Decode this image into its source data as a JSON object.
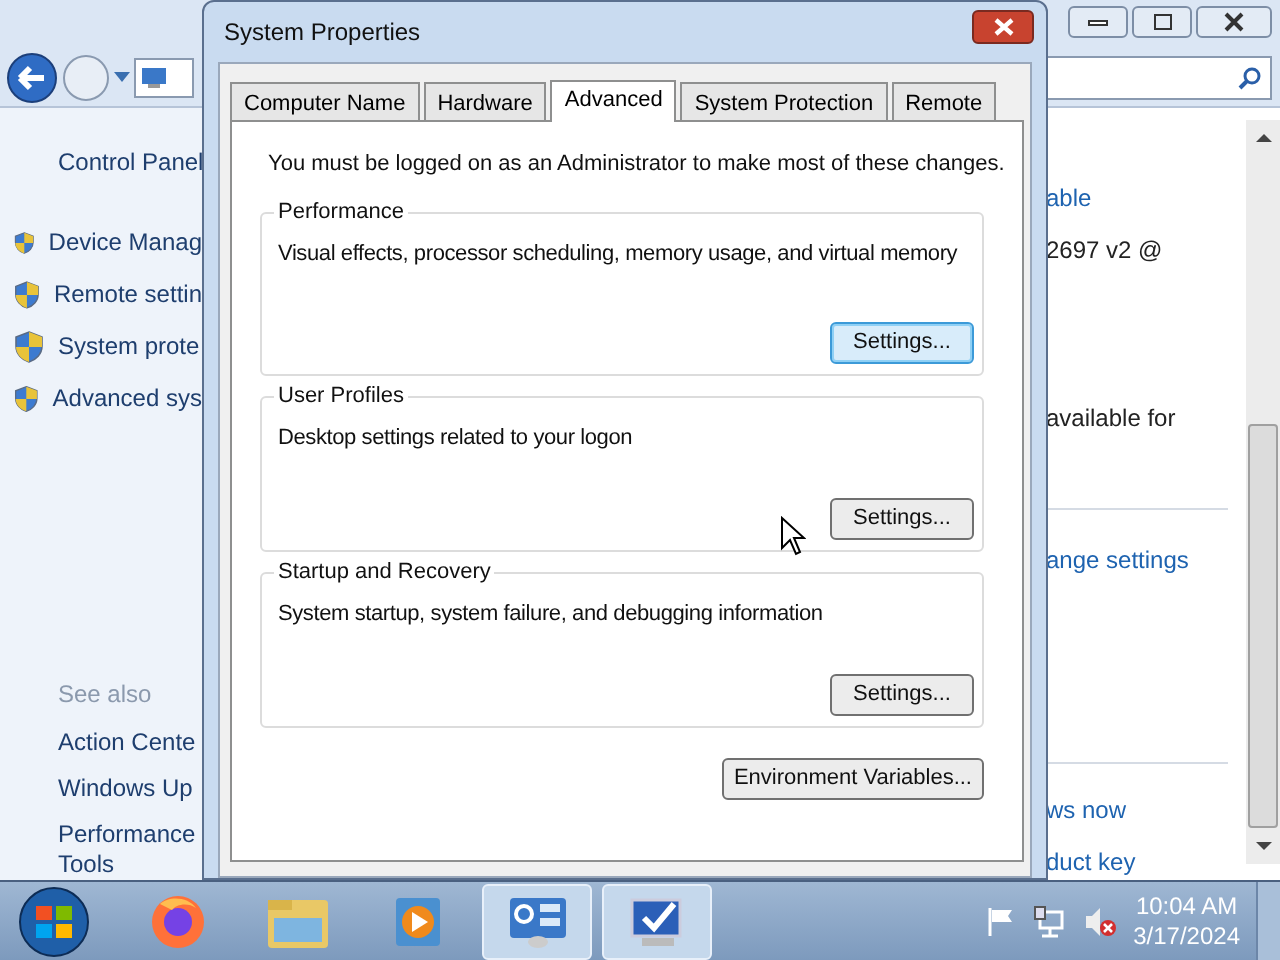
{
  "control_panel": {
    "sidebar": {
      "home_link": "Control Panel",
      "tasks": [
        "Device Manag",
        "Remote settin",
        "System prote",
        "Advanced sys"
      ],
      "see_also_heading": "See also",
      "see_also": [
        "Action Cente",
        "Windows Up",
        "Performance Tools"
      ]
    },
    "content_fragments": [
      {
        "text": "able",
        "kind": "link"
      },
      {
        "text": "2697 v2 @",
        "kind": "text"
      },
      {
        "text": "available for",
        "kind": "text"
      },
      {
        "text": "ange settings",
        "kind": "link"
      },
      {
        "text": "ws now",
        "kind": "link"
      },
      {
        "text": "duct key",
        "kind": "link"
      }
    ]
  },
  "dialog": {
    "title": "System Properties",
    "tabs": [
      {
        "label": "Computer Name",
        "selected": false
      },
      {
        "label": "Hardware",
        "selected": false
      },
      {
        "label": "Advanced",
        "selected": true
      },
      {
        "label": "System Protection",
        "selected": false
      },
      {
        "label": "Remote",
        "selected": false
      }
    ],
    "notice": "You must be logged on as an Administrator to make most of these changes.",
    "groups": [
      {
        "title": "Performance",
        "description": "Visual effects, processor scheduling, memory usage, and virtual memory",
        "button": "Settings...",
        "focused": true
      },
      {
        "title": "User Profiles",
        "description": "Desktop settings related to your logon",
        "button": "Settings...",
        "focused": false
      },
      {
        "title": "Startup and Recovery",
        "description": "System startup, system failure, and debugging information",
        "button": "Settings...",
        "focused": false
      }
    ],
    "environment_button": "Environment Variables..."
  },
  "taskbar": {
    "apps": [
      {
        "kind": "firefox",
        "active": false
      },
      {
        "kind": "explorer",
        "active": false
      },
      {
        "kind": "media",
        "active": false
      },
      {
        "kind": "control",
        "active": true
      },
      {
        "kind": "system",
        "active": true
      }
    ],
    "clock": {
      "time": "10:04 AM",
      "date": "3/17/2024"
    }
  }
}
